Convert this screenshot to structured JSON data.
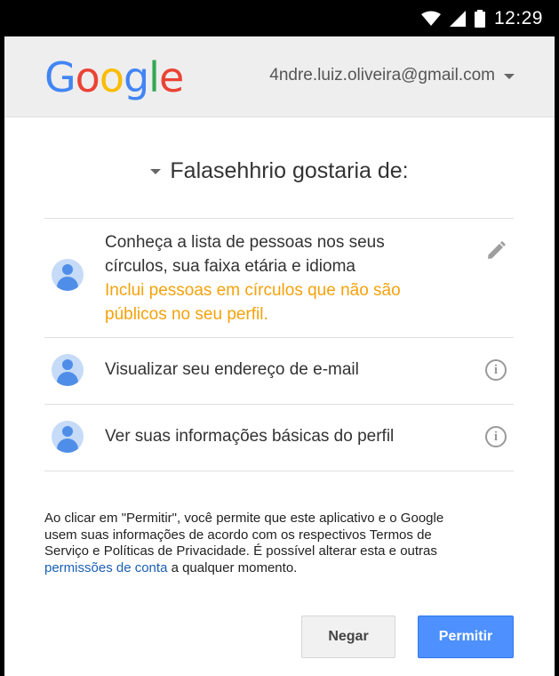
{
  "status_bar": {
    "time": "12:29"
  },
  "header": {
    "logo_letters": [
      {
        "ch": "G",
        "color": "#4285f4"
      },
      {
        "ch": "o",
        "color": "#ea4335"
      },
      {
        "ch": "o",
        "color": "#fbbc05"
      },
      {
        "ch": "g",
        "color": "#4285f4"
      },
      {
        "ch": "l",
        "color": "#34a853"
      },
      {
        "ch": "e",
        "color": "#ea4335"
      }
    ],
    "account_email": "4ndre.luiz.oliveira@gmail.com"
  },
  "request": {
    "title": "Falasehhrio gostaria de:"
  },
  "permissions": [
    {
      "line1": "Conheça a lista de pessoas nos seus",
      "line2": "círculos, sua faixa etária e idioma",
      "warning1": "Inclui pessoas em círculos que não são",
      "warning2": "públicos no seu perfil.",
      "icon": "pencil-icon"
    },
    {
      "text": "Visualizar seu endereço de e-mail",
      "icon": "info-icon"
    },
    {
      "text": "Ver suas informações básicas do perfil",
      "icon": "info-icon"
    }
  ],
  "disclaimer": {
    "line1": "Ao clicar em \"Permitir\", você permite que este aplicativo e o Google",
    "line2": "usem suas informações de acordo com os respectivos Termos de",
    "line3": "Serviço e Políticas de Privacidade. É possível alterar esta e outras",
    "link": "permissões de conta",
    "after_link": " a qualquer momento."
  },
  "buttons": {
    "deny": "Negar",
    "allow": "Permitir"
  },
  "colors": {
    "allow": "#4d90fe",
    "warning": "#f4a20b",
    "link": "#1a5fb4",
    "avatar": "#4f8ee8"
  }
}
